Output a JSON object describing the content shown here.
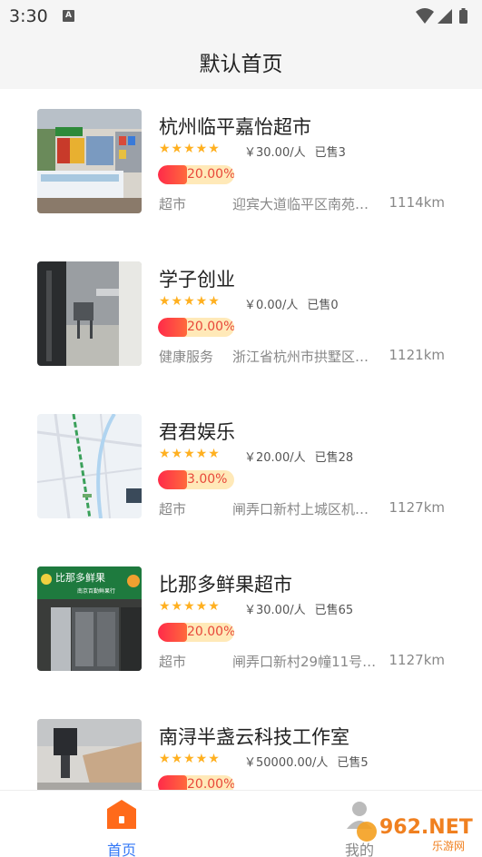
{
  "status_bar": {
    "time": "3:30",
    "notification_icon": "A"
  },
  "nav": {
    "title": "默认首页"
  },
  "stores": [
    {
      "name": "杭州临平嘉怡超市",
      "stars": "★★★★★",
      "price": "￥30.00/人",
      "sold": "已售3",
      "discount": "20.00%",
      "category": "超市",
      "address": "迎宾大道临平区南苑…",
      "distance": "1114km"
    },
    {
      "name": "学子创业",
      "stars": "★★★★★",
      "price": "￥0.00/人",
      "sold": "已售0",
      "discount": "20.00%",
      "category": "健康服务",
      "address": "浙江省杭州市拱墅区…",
      "distance": "1121km"
    },
    {
      "name": "君君娱乐",
      "stars": "★★★★★",
      "price": "￥20.00/人",
      "sold": "已售28",
      "discount": "3.00%",
      "category": "超市",
      "address": "闸弄口新村上城区机…",
      "distance": "1127km"
    },
    {
      "name": "比那多鲜果超市",
      "stars": "★★★★★",
      "price": "￥30.00/人",
      "sold": "已售65",
      "discount": "20.00%",
      "category": "超市",
      "address": "闸弄口新村29幢11号…",
      "distance": "1127km"
    },
    {
      "name": "南浔半盏云科技工作室",
      "stars": "★★★★★",
      "price": "￥50000.00/人",
      "sold": "已售5",
      "discount": "20.00%",
      "category": "",
      "address": "",
      "distance": ""
    }
  ],
  "shop_sign": {
    "line1": "比那多鲜果",
    "line2": "南京百勤鲜果行"
  },
  "tabs": {
    "home": "首页",
    "mine": "我的"
  },
  "watermark": {
    "text": "962.NET",
    "sub": "乐游网"
  },
  "colors": {
    "accent": "#3478f6",
    "home_icon": "#ff6a1a",
    "star": "#ffb020",
    "discount": "#e8483a"
  }
}
